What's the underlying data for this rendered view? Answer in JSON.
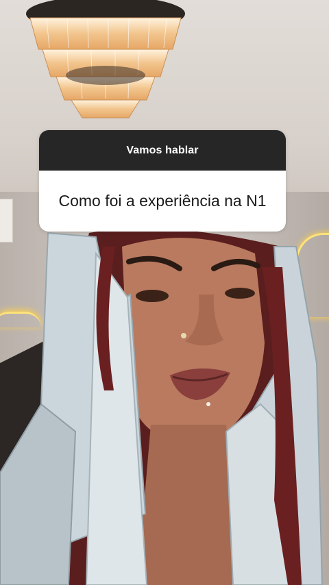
{
  "question_sticker": {
    "prompt": "Vamos hablar",
    "question": "Como foi a experiência na N1"
  },
  "colors": {
    "sticker_header_bg": "#262626",
    "sticker_body_bg": "#ffffff",
    "neon": "#ffe27a"
  }
}
